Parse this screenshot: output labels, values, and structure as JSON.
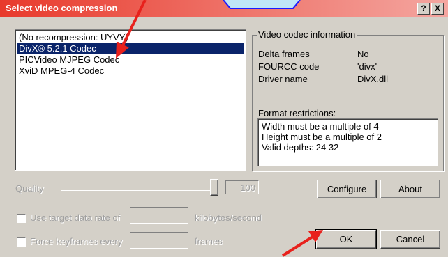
{
  "window": {
    "title": "Select video compression",
    "help_glyph": "?",
    "close_glyph": "X"
  },
  "codecs": [
    {
      "label": "(No recompression: UYVY)",
      "selected": false
    },
    {
      "label": "DivX® 5.2.1 Codec",
      "selected": true
    },
    {
      "label": "PICVideo MJPEG Codec",
      "selected": false
    },
    {
      "label": "XviD MPEG-4 Codec",
      "selected": false
    }
  ],
  "codec_info": {
    "group_title": "Video codec information",
    "rows": [
      {
        "label": "Delta frames",
        "value": "No"
      },
      {
        "label": "FOURCC code",
        "value": "'divx'"
      },
      {
        "label": "Driver name",
        "value": "DivX.dll"
      }
    ],
    "restrictions_title": "Format restrictions:",
    "restrictions": [
      "Width must be a multiple of 4",
      "Height must be a multiple of 2",
      "Valid depths: 24 32"
    ]
  },
  "quality": {
    "label": "Quality",
    "value": "100"
  },
  "buttons": {
    "configure": "Configure",
    "about": "About",
    "ok": "OK",
    "cancel": "Cancel"
  },
  "options": {
    "data_rate_label": "Use target data rate of",
    "data_rate_unit": "kilobytes/second",
    "keyframes_label": "Force keyframes every",
    "keyframes_unit": "frames"
  },
  "annotation_color": "#e8211c"
}
